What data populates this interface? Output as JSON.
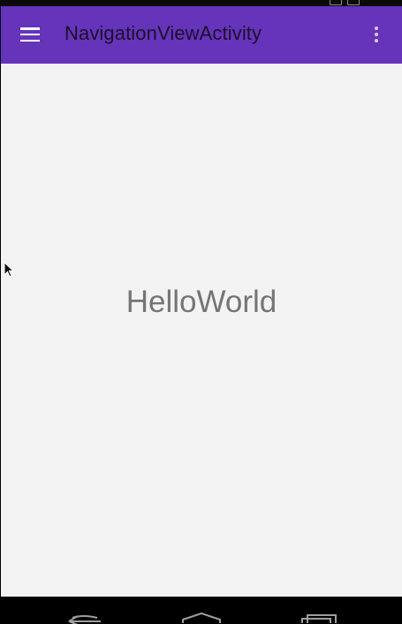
{
  "app": {
    "title": "NavigationViewActivity"
  },
  "toolbar": {
    "nav_icon": "hamburger-menu-icon",
    "overflow_icon": "more-vert-icon"
  },
  "main": {
    "text": "HelloWorld"
  },
  "navigation_bar": {
    "buttons": [
      "back-icon",
      "home-icon",
      "recents-icon"
    ]
  },
  "colors": {
    "toolbar": "#6633bb",
    "content_bg": "#f3f3f3",
    "text": "#757575"
  }
}
